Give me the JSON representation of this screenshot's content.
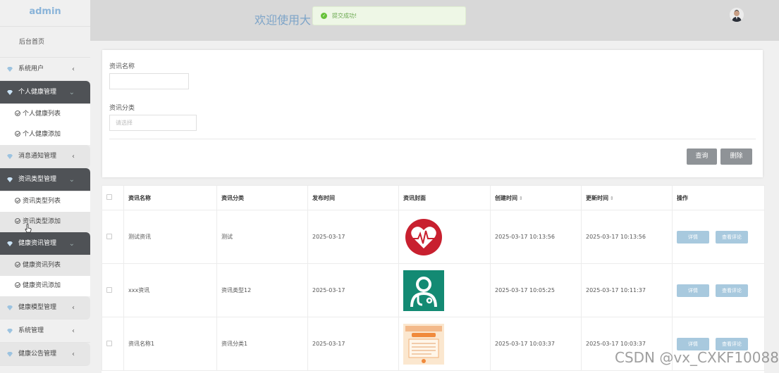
{
  "brand": "admin",
  "header": {
    "welcome": "欢迎使用大"
  },
  "toast": {
    "text": "提交成功!"
  },
  "sidebar": {
    "home": "后台首页",
    "menus": [
      {
        "label": "系统用户",
        "open": false,
        "subs": []
      },
      {
        "label": "个人健康管理",
        "open": true,
        "subs": [
          "个人健康列表",
          "个人健康添加"
        ]
      },
      {
        "label": "消息通知管理",
        "open": false,
        "subs": []
      },
      {
        "label": "资讯类型管理",
        "open": true,
        "subs": [
          "资讯类型列表",
          "资讯类型添加"
        ]
      },
      {
        "label": "健康资讯管理",
        "open": true,
        "subs": [
          "健康资讯列表",
          "健康资讯添加"
        ]
      },
      {
        "label": "健康模型管理",
        "open": false,
        "subs": []
      },
      {
        "label": "系统管理",
        "open": false,
        "subs": []
      },
      {
        "label": "健康公告管理",
        "open": false,
        "subs": []
      }
    ]
  },
  "search": {
    "name_label": "资讯名称",
    "name_value": "",
    "type_label": "资讯分类",
    "type_placeholder": "请选择",
    "query_button": "查询",
    "delete_button": "删除"
  },
  "table": {
    "headers": [
      "资讯名称",
      "资讯分类",
      "发布时间",
      "资讯封面",
      "创建时间",
      "更新时间",
      "操作"
    ],
    "sort_icon": "⇕",
    "rows": [
      {
        "name": "测试资讯",
        "type": "测试",
        "publish": "2025-03-17",
        "cover": "heart-icon",
        "created": "2025-03-17 10:13:56",
        "updated": "2025-03-17 10:13:56"
      },
      {
        "name": "xxx资讯",
        "type": "资讯类型12",
        "publish": "2025-03-17",
        "cover": "doctor-icon",
        "created": "2025-03-17 10:05:25",
        "updated": "2025-03-17 10:11:37"
      },
      {
        "name": "资讯名称1",
        "type": "资讯分类1",
        "publish": "2025-03-17",
        "cover": "poster-image",
        "created": "2025-03-17 10:03:37",
        "updated": "2025-03-17 10:03:37"
      }
    ],
    "detail_button": "详情",
    "comment_button": "查看评论"
  },
  "watermark": "CSDN @vx_CXKF10088"
}
